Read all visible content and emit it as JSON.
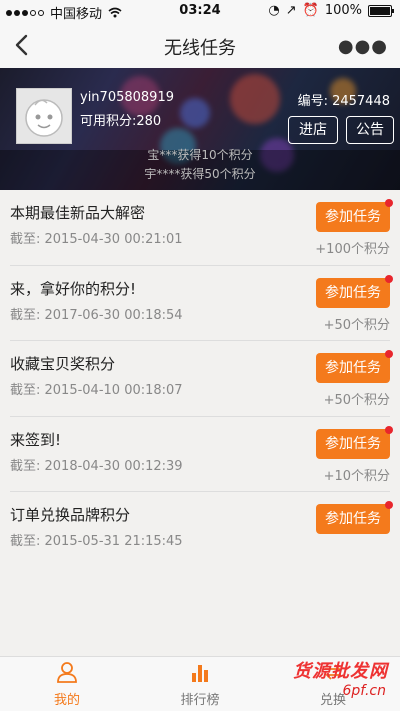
{
  "status_bar": {
    "carrier": "中国移动",
    "time": "03:24",
    "battery": "100%"
  },
  "nav": {
    "title": "无线任务"
  },
  "profile": {
    "username": "yin705808919",
    "points_label": "可用积分:280",
    "id_label": "编号: 2457448",
    "shop_button": "进店",
    "notice_button": "公告"
  },
  "ticker": {
    "line1": "宝***获得10个积分",
    "line2": "宇****获得50个积分"
  },
  "tasks": [
    {
      "name": "本期最佳新品大解密",
      "deadline": "截至: 2015-04-30 00:21:01",
      "button": "参加任务",
      "reward": "+100个积分"
    },
    {
      "name": "来，拿好你的积分!",
      "deadline": "截至: 2017-06-30 00:18:54",
      "button": "参加任务",
      "reward": "+50个积分"
    },
    {
      "name": "收藏宝贝奖积分",
      "deadline": "截至: 2015-04-10 00:18:07",
      "button": "参加任务",
      "reward": "+50个积分"
    },
    {
      "name": "来签到!",
      "deadline": "截至: 2018-04-30 00:12:39",
      "button": "参加任务",
      "reward": "+10个积分"
    },
    {
      "name": "订单兑换品牌积分",
      "deadline": "截至: 2015-05-31 21:15:45",
      "button": "参加任务",
      "reward": ""
    }
  ],
  "tabbar": {
    "mine": "我的",
    "ranking": "排行榜",
    "exchange": "兑换"
  },
  "watermark": {
    "line1": "货源批发网",
    "line2": "6pf.cn"
  },
  "colors": {
    "accent": "#f47a1c",
    "red_dot": "#e8262d"
  }
}
